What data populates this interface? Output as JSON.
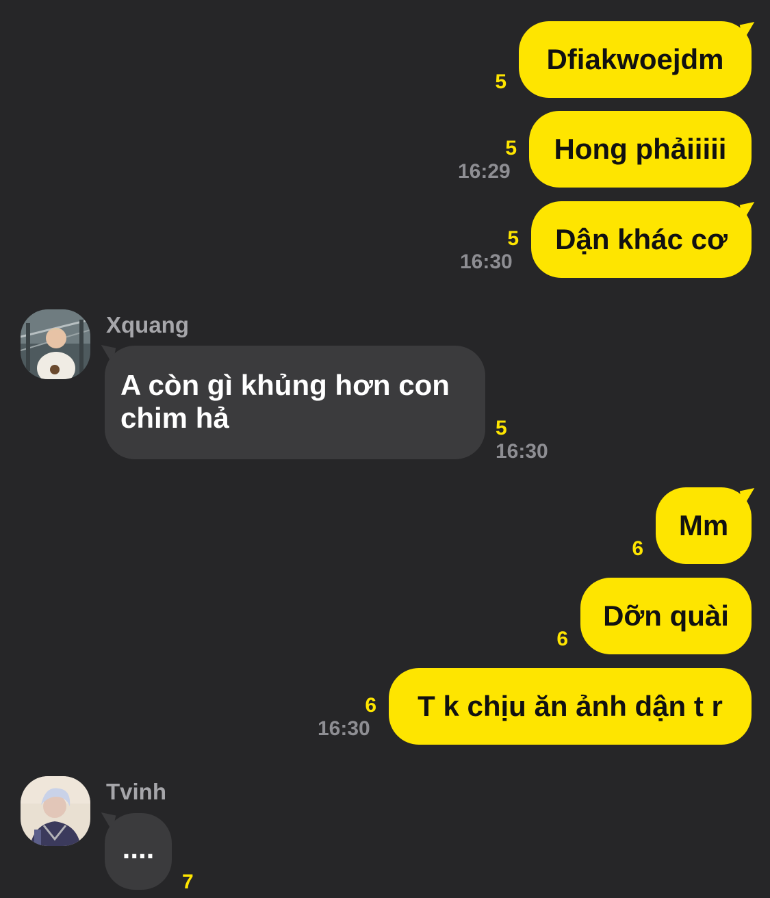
{
  "colors": {
    "background": "#262628",
    "outgoing_bubble": "#FEE500",
    "incoming_bubble": "#3B3B3D",
    "unread_count": "#FEE500",
    "timestamp": "#8E8E93"
  },
  "messages": [
    {
      "direction": "out",
      "text": "Dfiakwoejdm",
      "unread": "5",
      "time": ""
    },
    {
      "direction": "out",
      "text": "Hong phảiiiii",
      "unread": "5",
      "time": "16:29"
    },
    {
      "direction": "out",
      "text": "Dận khác cơ",
      "unread": "5",
      "time": "16:30"
    },
    {
      "direction": "in",
      "sender": "Xquang",
      "avatar": "xquang-avatar",
      "text_lines": [
        "A còn gì khủng hơn con",
        "chim hả"
      ],
      "unread": "5",
      "time": "16:30"
    },
    {
      "direction": "out",
      "text": "Mm",
      "unread": "6",
      "time": ""
    },
    {
      "direction": "out",
      "text": "Dỡn quài",
      "unread": "6",
      "time": ""
    },
    {
      "direction": "out",
      "text": "T k chịu ăn ảnh dận t r",
      "unread": "6",
      "time": "16:30"
    },
    {
      "direction": "in",
      "sender": "Tvinh",
      "avatar": "tvinh-avatar",
      "text_lines": [
        "...."
      ],
      "unread": "7",
      "time": ""
    }
  ]
}
